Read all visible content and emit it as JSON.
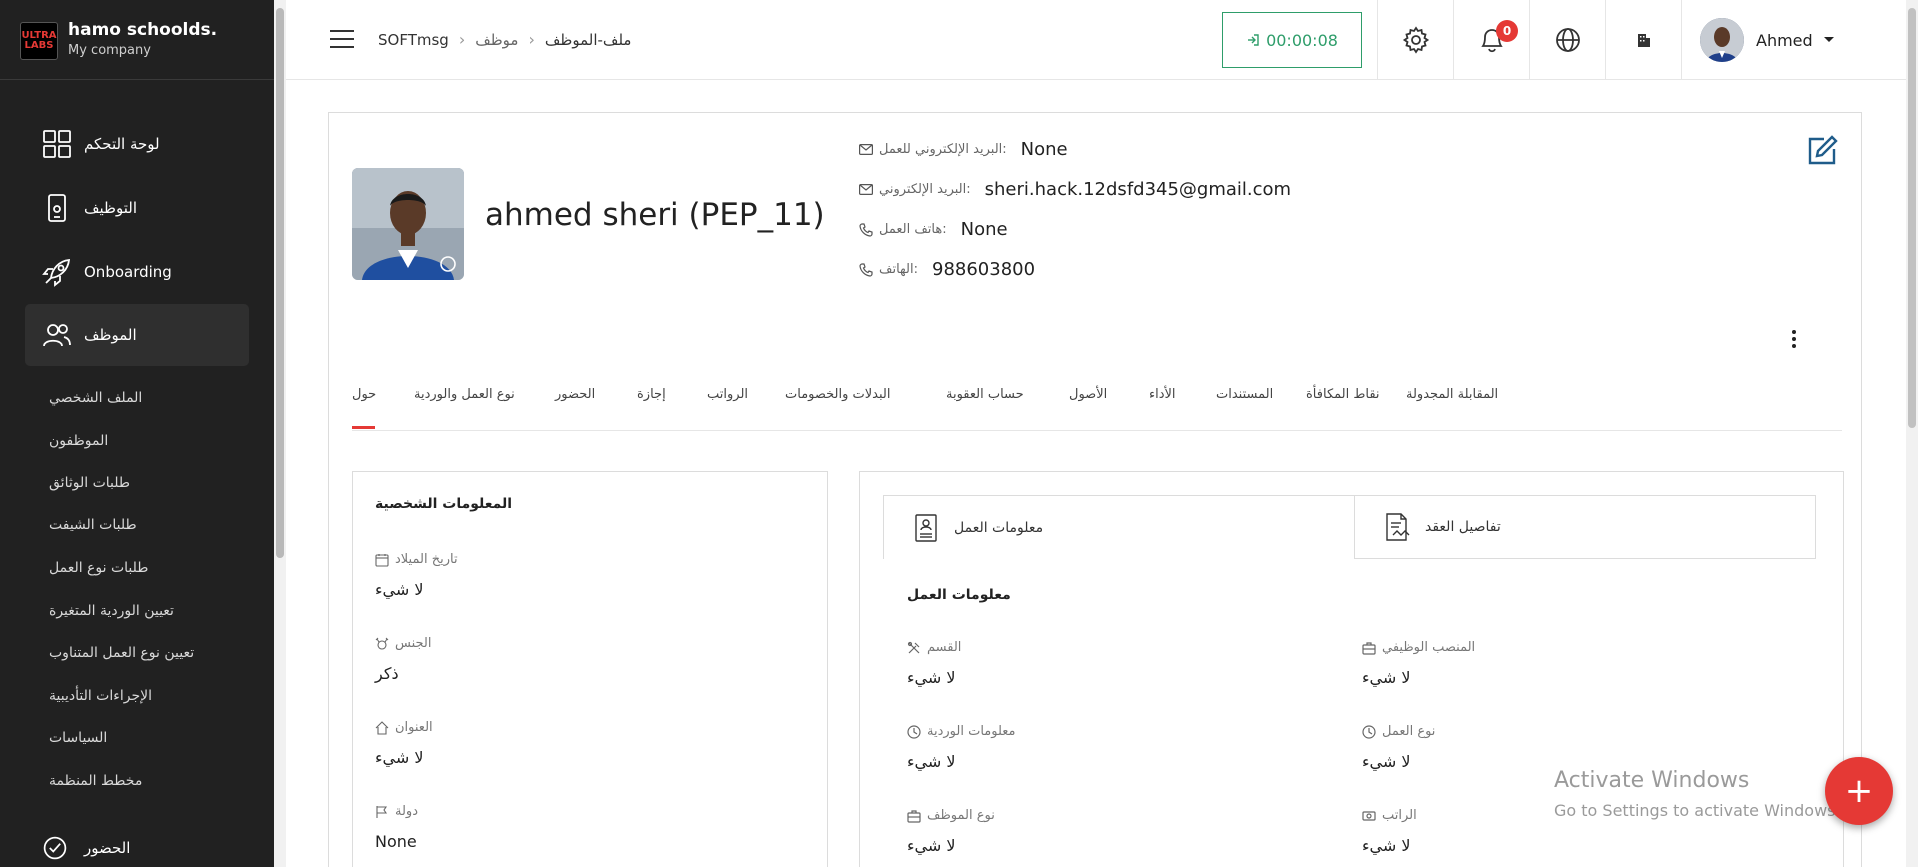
{
  "sidebar": {
    "logo_text": "ULTRA LABS",
    "company_name": "hamo schoolds.",
    "company_sub": "My company",
    "nav": [
      {
        "label": "لوحة التحكم",
        "icon": "dashboard-grid-icon"
      },
      {
        "label": "التوظيف",
        "icon": "mobile-phone-icon"
      },
      {
        "label": "Onboarding",
        "icon": "rocket-icon"
      },
      {
        "label": "الموظف",
        "icon": "users-icon"
      },
      {
        "label": "الحضور",
        "icon": "check-circle-icon"
      }
    ],
    "sub_items": [
      "الملف الشخصي",
      "الموظفون",
      "طلبات الوثائق",
      "طلبات الشيفت",
      "طلبات نوع العمل",
      "تعيين الوردية المتغيرة",
      "تعيين نوع العمل المتناوب",
      "الإجراءات التأديبية",
      "السياسات",
      "مخطط المنظمة"
    ]
  },
  "header": {
    "breadcrumb": [
      "SOFTmsg",
      "موظف",
      "ملف-الموظف"
    ],
    "timer": "00:00:08",
    "notification_count": "0",
    "user_name": "Ahmed"
  },
  "profile": {
    "name": "ahmed sheri (PEP_11)",
    "work_email_label": "البريد الإلكتروني للعمل:",
    "work_email": "None",
    "email_label": "البريد الإلكتروني:",
    "email": "sheri.hack.12dsfd345@gmail.com",
    "work_phone_label": "هاتف العمل:",
    "work_phone": "None",
    "phone_label": "الهاتف:",
    "phone": "988603800"
  },
  "tabs": [
    "حول",
    "نوع العمل والوردية",
    "الحضور",
    "إجازة",
    "الرواتب",
    "البدلات والخصومات",
    "حساب العقوبة",
    "الأصول",
    "الأداء",
    "المستندات",
    "نقاط المكافأة",
    "المقابلة المجدولة"
  ],
  "personal": {
    "title": "المعلومات الشخصية",
    "fields": [
      {
        "label": "تاريخ الميلاد",
        "value": "لا شيء",
        "icon": "calendar-icon"
      },
      {
        "label": "الجنس",
        "value": "ذكر",
        "icon": "gender-icon"
      },
      {
        "label": "العنوان",
        "value": "لا شيء",
        "icon": "home-icon"
      },
      {
        "label": "دولة",
        "value": "None",
        "icon": "flag-icon"
      }
    ]
  },
  "work": {
    "subtab_work": "معلومات العمل",
    "subtab_contract": "تفاصيل العقد",
    "title": "معلومات العمل",
    "left_fields": [
      {
        "label": "القسم",
        "value": "لا شيء",
        "icon": "tools-icon"
      },
      {
        "label": "معلومات الوردية",
        "value": "لا شيء",
        "icon": "clock-icon"
      },
      {
        "label": "نوع الموظف",
        "value": "لا شيء",
        "icon": "briefcase-icon"
      }
    ],
    "right_fields": [
      {
        "label": "المنصب الوظيفي",
        "value": "لا شيء",
        "icon": "briefcase-icon"
      },
      {
        "label": "نوع العمل",
        "value": "لا شيء",
        "icon": "clock-icon"
      },
      {
        "label": "الراتب",
        "value": "لا شيء",
        "icon": "money-icon"
      }
    ]
  },
  "watermark": {
    "line1": "Activate Windows",
    "line2": "Go to Settings to activate Windows."
  },
  "fab_label": "+"
}
